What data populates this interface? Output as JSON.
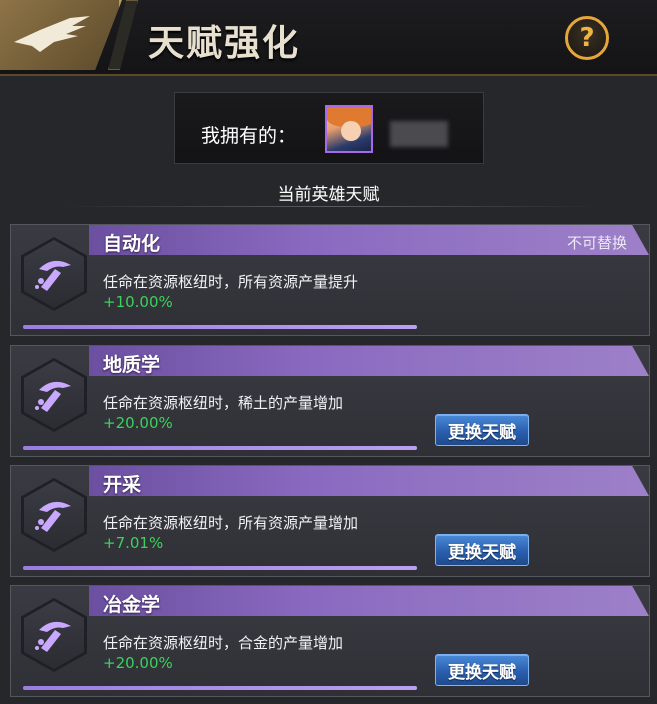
{
  "header": {
    "title": "天赋强化",
    "help_icon": "question-mark-icon",
    "help_label": "?",
    "logo_icon": "eagle-wing-icon"
  },
  "owned": {
    "label": "我拥有的：",
    "avatar_icon": "hero-avatar-icon"
  },
  "section": {
    "title": "当前英雄天赋"
  },
  "colors": {
    "accent_purple": "#8a6ac0",
    "bonus_green": "#3ad25a",
    "button_blue": "#2a5fae",
    "help_gold": "#e6a63a"
  },
  "talents": [
    {
      "name": "自动化",
      "flag": "不可替换",
      "desc": "任命在资源枢纽时，所有资源产量提升",
      "bonus": "+10.00%",
      "icon": "hammer-pick-icon",
      "button": "",
      "progress": 1.0
    },
    {
      "name": "地质学",
      "flag": "",
      "desc": "任命在资源枢纽时，稀土的产量增加",
      "bonus": "+20.00%",
      "icon": "hammer-pick-icon",
      "button": "更换天赋",
      "progress": 1.0
    },
    {
      "name": "开采",
      "flag": "",
      "desc": "任命在资源枢纽时，所有资源产量增加",
      "bonus": "+7.01%",
      "icon": "hammer-pick-icon",
      "button": "更换天赋",
      "progress": 1.0
    },
    {
      "name": "冶金学",
      "flag": "",
      "desc": "任命在资源枢纽时，合金的产量增加",
      "bonus": "+20.00%",
      "icon": "hammer-pick-icon",
      "button": "更换天赋",
      "progress": 1.0
    }
  ]
}
